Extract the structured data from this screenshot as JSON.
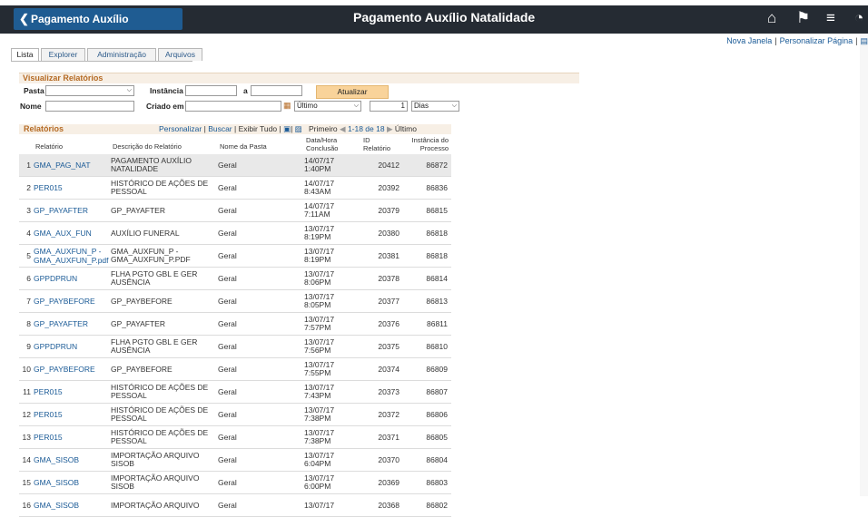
{
  "header": {
    "back_label": "Pagamento Auxílio Natalidade",
    "title": "Pagamento Auxílio Natalidade"
  },
  "top_links": {
    "new_window": "Nova Janela",
    "personalize": "Personalizar Página"
  },
  "tabs": [
    "Lista",
    "Explorer",
    "Administração",
    "Arquivos"
  ],
  "view_reports": {
    "title": "Visualizar Relatórios",
    "folder_label": "Pasta",
    "folder_value": "",
    "instance_label": "Instância",
    "instance_from": "",
    "instance_to_label": "a",
    "instance_to": "",
    "refresh_label": "Atualizar",
    "name_label": "Nome",
    "name_value": "",
    "created_label": "Criado em",
    "created_value": "",
    "period_value": "Último",
    "count_value": "1",
    "unit_value": "Dias"
  },
  "reports_table": {
    "title": "Relatórios",
    "personalize": "Personalizar",
    "search": "Buscar",
    "show_all": "Exibir Tudo",
    "first": "Primeiro",
    "range": "1-18 de 18",
    "last": "Último",
    "columns": {
      "relatorio": "Relatório",
      "descricao": "Descrição do Relatório",
      "pasta": "Nome da Pasta",
      "data_l1": "Data/Hora",
      "data_l2": "Conclusão",
      "id_l1": "ID",
      "id_l2": "Relatório",
      "inst_l1": "Instância do",
      "inst_l2": "Processo"
    },
    "rows": [
      {
        "n": "1",
        "rel": "GMA_PAG_NAT",
        "desc": "PAGAMENTO AUXÍLIO NATALIDADE",
        "pasta": "Geral",
        "date": "14/07/17",
        "time": "1:40PM",
        "id": "20412",
        "inst": "86872"
      },
      {
        "n": "2",
        "rel": "PER015",
        "desc": "HISTÓRICO DE AÇÕES DE PESSOAL",
        "pasta": "Geral",
        "date": "14/07/17",
        "time": "8:43AM",
        "id": "20392",
        "inst": "86836"
      },
      {
        "n": "3",
        "rel": "GP_PAYAFTER",
        "desc": "GP_PAYAFTER",
        "pasta": "Geral",
        "date": "14/07/17",
        "time": "7:11AM",
        "id": "20379",
        "inst": "86815"
      },
      {
        "n": "4",
        "rel": "GMA_AUX_FUN",
        "desc": "AUXÍLIO FUNERAL",
        "pasta": "Geral",
        "date": "13/07/17",
        "time": "8:19PM",
        "id": "20380",
        "inst": "86818"
      },
      {
        "n": "5",
        "rel": "GMA_AUXFUN_P - GMA_AUXFUN_P.pdf",
        "desc": "GMA_AUXFUN_P - GMA_AUXFUN_P.PDF",
        "pasta": "Geral",
        "date": "13/07/17",
        "time": "8:19PM",
        "id": "20381",
        "inst": "86818"
      },
      {
        "n": "6",
        "rel": "GPPDPRUN",
        "desc": "FLHA PGTO GBL E GER AUSÊNCIA",
        "pasta": "Geral",
        "date": "13/07/17",
        "time": "8:06PM",
        "id": "20378",
        "inst": "86814"
      },
      {
        "n": "7",
        "rel": "GP_PAYBEFORE",
        "desc": "GP_PAYBEFORE",
        "pasta": "Geral",
        "date": "13/07/17",
        "time": "8:05PM",
        "id": "20377",
        "inst": "86813"
      },
      {
        "n": "8",
        "rel": "GP_PAYAFTER",
        "desc": "GP_PAYAFTER",
        "pasta": "Geral",
        "date": "13/07/17",
        "time": "7:57PM",
        "id": "20376",
        "inst": "86811"
      },
      {
        "n": "9",
        "rel": "GPPDPRUN",
        "desc": "FLHA PGTO GBL E GER AUSÊNCIA",
        "pasta": "Geral",
        "date": "13/07/17",
        "time": "7:56PM",
        "id": "20375",
        "inst": "86810"
      },
      {
        "n": "10",
        "rel": "GP_PAYBEFORE",
        "desc": "GP_PAYBEFORE",
        "pasta": "Geral",
        "date": "13/07/17",
        "time": "7:55PM",
        "id": "20374",
        "inst": "86809"
      },
      {
        "n": "11",
        "rel": "PER015",
        "desc": "HISTÓRICO DE AÇÕES DE PESSOAL",
        "pasta": "Geral",
        "date": "13/07/17",
        "time": "7:43PM",
        "id": "20373",
        "inst": "86807"
      },
      {
        "n": "12",
        "rel": "PER015",
        "desc": "HISTÓRICO DE AÇÕES DE PESSOAL",
        "pasta": "Geral",
        "date": "13/07/17",
        "time": "7:38PM",
        "id": "20372",
        "inst": "86806"
      },
      {
        "n": "13",
        "rel": "PER015",
        "desc": "HISTÓRICO DE AÇÕES DE PESSOAL",
        "pasta": "Geral",
        "date": "13/07/17",
        "time": "7:38PM",
        "id": "20371",
        "inst": "86805"
      },
      {
        "n": "14",
        "rel": "GMA_SISOB",
        "desc": "IMPORTAÇÃO ARQUIVO SISOB",
        "pasta": "Geral",
        "date": "13/07/17",
        "time": "6:04PM",
        "id": "20370",
        "inst": "86804"
      },
      {
        "n": "15",
        "rel": "GMA_SISOB",
        "desc": "IMPORTAÇÃO ARQUIVO SISOB",
        "pasta": "Geral",
        "date": "13/07/17",
        "time": "6:00PM",
        "id": "20369",
        "inst": "86803"
      },
      {
        "n": "16",
        "rel": "GMA_SISOB",
        "desc": "IMPORTAÇÃO ARQUIVO",
        "pasta": "Geral",
        "date": "13/07/17",
        "time": "",
        "id": "20368",
        "inst": "86802"
      }
    ]
  },
  "icons": {
    "home": "home-icon",
    "flag": "flag-icon",
    "menu": "hamburger-menu-icon",
    "nav": "navbar-compass-icon"
  },
  "colors": {
    "topbar": "#252b33",
    "back_button": "#1f5c92",
    "section_header": "#b56b25",
    "link": "#1a5a96",
    "refresh_button": "#f9d39a"
  }
}
